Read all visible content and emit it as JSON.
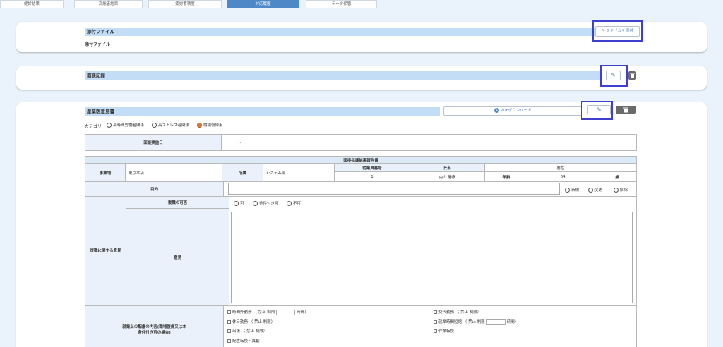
{
  "tabs": [
    {
      "label": "健診結果",
      "active": false
    },
    {
      "label": "高総者結果",
      "active": false
    },
    {
      "label": "疲労蓄積度",
      "active": false
    },
    {
      "label": "対応履歴",
      "active": true
    },
    {
      "label": "データ保管",
      "active": false
    }
  ],
  "attachment": {
    "title": "添付ファイル",
    "sublabel": "添付ファイル",
    "button_label": "ファイルを添付"
  },
  "interview": {
    "title": "面談記録"
  },
  "opinion": {
    "title": "産業医意見書",
    "pdf_button": "PDFダウンロード",
    "category_label": "カテゴリ",
    "categories": [
      {
        "label": "長時間労働者関係",
        "selected": false
      },
      {
        "label": "高ストレス者関係",
        "selected": false
      },
      {
        "label": "職場復帰用",
        "selected": true
      }
    ],
    "date_label": "面談実施日",
    "date_value": "～"
  },
  "report": {
    "title": "面接指導結果報告書",
    "office_label": "事業場",
    "office_value": "東京本店",
    "dept_label": "所属",
    "dept_value": "システム部",
    "emp_no_label": "従業員番号",
    "emp_no_value": "1",
    "name_label": "氏名",
    "name_value": "内山 勝彦",
    "gender_value": "男性",
    "age_label": "年齢",
    "age_value": "64",
    "age_unit": "歳",
    "purpose_label": "目的",
    "purpose_options": [
      "新規",
      "変更",
      "解除"
    ],
    "return_group_label": "復職に関する意見",
    "return_possible_label": "復職の可否",
    "return_options": [
      "可",
      "条件付き可",
      "不可"
    ],
    "opinion_label": "意見",
    "considerations_label": "就業上の配慮の内容(職場復帰又は本条件付き可の場合)",
    "left_items": [
      {
        "label": "時間外勤務",
        "detail": "（ 禁止 制限",
        "suffix": "時間）"
      },
      {
        "label": "休日勤務",
        "detail": "（ 禁止 制限）",
        "suffix": ""
      },
      {
        "label": "出張",
        "detail": "（ 禁止 制限）",
        "suffix": ""
      },
      {
        "label": "配置転換・異動",
        "detail": "",
        "suffix": ""
      }
    ],
    "right_items": [
      {
        "label": "交代勤務",
        "detail": "（ 禁止 制限）",
        "suffix": ""
      },
      {
        "label": "就業時間短縮",
        "detail": "（ 禁止 制限",
        "suffix": "時間）"
      },
      {
        "label": "作業転換",
        "detail": "",
        "suffix": ""
      }
    ]
  }
}
